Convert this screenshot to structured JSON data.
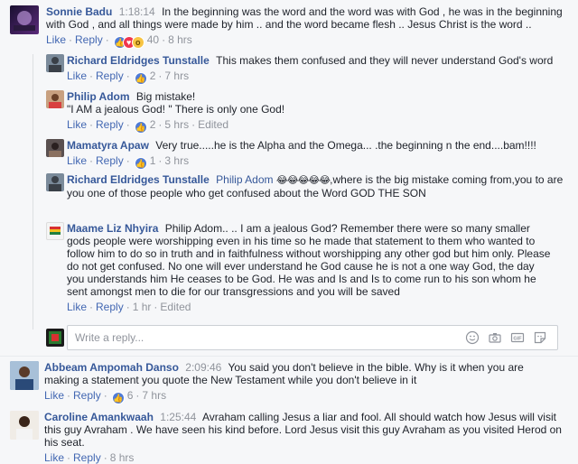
{
  "comments": [
    {
      "name": "Sonnie Badu",
      "time": "1:18:14",
      "text": "In the beginning was the word and the word was with God , he was in the beginning with God , and all things were made by him .. and the word became flesh .. Jesus Christ is the word ..",
      "like": "Like",
      "reply": "Reply",
      "reactions": "40",
      "age": "8 hrs"
    },
    {
      "name": "Richard Eldridges Tunstalle",
      "text": "This makes them confused and they will never understand God's word",
      "like": "Like",
      "reply": "Reply",
      "reactions": "2",
      "age": "7 hrs"
    },
    {
      "name": "Philip Adom",
      "text": "Big mistake!",
      "text2": "\"I AM a jealous God! \" There is only one God!",
      "like": "Like",
      "reply": "Reply",
      "reactions": "2",
      "age": "5 hrs",
      "edited": "Edited"
    },
    {
      "name": "Mamatyra Apaw",
      "text": "Very true.....he is the Alpha and the Omega... .the beginning n the end....bam!!!!",
      "like": "Like",
      "reply": "Reply",
      "reactions": "1",
      "age": "3 hrs"
    },
    {
      "name": "Richard Eldridges Tunstalle",
      "mention": "Philip Adom",
      "emojis": "😂😂😂😂😂",
      "text": ",where is the big mistake coming from,you to are you one of those people who get confused about the Word GOD THE SON"
    },
    {
      "name": "Maame Liz Nhyira",
      "text": "Philip Adom.. .. I am a jealous God? Remember there were so many smaller gods people were worshipping even in his time so he made that statement to them who wanted to follow him to do so in truth and in faithfulness without worshipping any other god but him only. Please do not get confused. No one will ever understand he God cause he is not a one way God, the day you understands him He ceases to be God. He was and Is and Is to come run to his son whom he sent amongst men to die for our transgressions and you will be saved",
      "like": "Like",
      "reply": "Reply",
      "age": "1 hr",
      "edited": "Edited"
    },
    {
      "name": "Abbeam Ampomah Danso",
      "time": "2:09:46",
      "text": "You said you don't believe in the bible. Why is it when you are making a statement you quote the New Testament while you don't believe in it",
      "like": "Like",
      "reply": "Reply",
      "reactions": "6",
      "age": "7 hrs"
    },
    {
      "name": "Caroline Amankwaah",
      "time": "1:25:44",
      "text": "Avraham calling Jesus a liar and fool. All should watch how Jesus will visit this guy Avraham . We have seen his kind before. Lord Jesus visit this guy Avraham as you visited Herod on his seat.",
      "like": "Like",
      "reply": "Reply",
      "age": "8 hrs"
    }
  ],
  "replybox": {
    "placeholder": "Write a reply..."
  },
  "colors": {
    "link": "#365899",
    "meta": "#90949c",
    "background": "#f6f7f9"
  }
}
